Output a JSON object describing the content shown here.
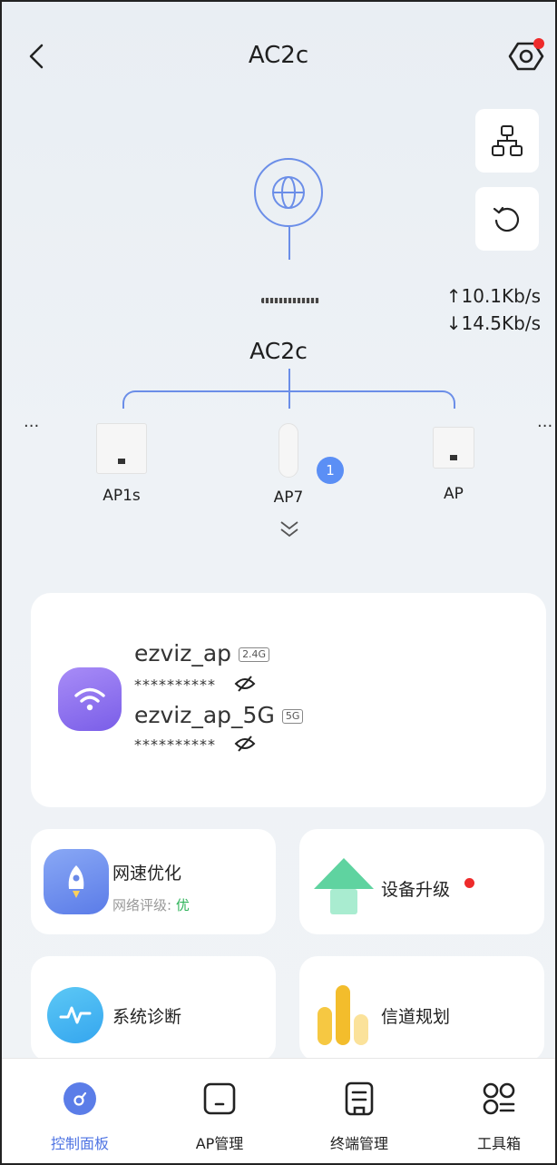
{
  "header": {
    "title": "AC2c"
  },
  "topology": {
    "upload_speed": "10.1Kb/s",
    "download_speed": "14.5Kb/s",
    "upload_arrow": "↑",
    "download_arrow": "↓",
    "controller_label": "AC2c",
    "more_left": "...",
    "more_right": "...",
    "aps": [
      {
        "label": "AP1s"
      },
      {
        "label": "AP7",
        "badge": "1"
      },
      {
        "label": "AP"
      }
    ]
  },
  "wifi": {
    "networks": [
      {
        "ssid": "ezviz_ap",
        "band": "2.4G",
        "password": "**********"
      },
      {
        "ssid": "ezviz_ap_5G",
        "band": "5G",
        "password": "**********"
      }
    ]
  },
  "features": {
    "speed_opt": {
      "title": "网速优化",
      "sub_prefix": "网络评级: ",
      "sub_value": "优"
    },
    "upgrade": {
      "title": "设备升级"
    },
    "diagnose": {
      "title": "系统诊断"
    },
    "channel": {
      "title": "信道规划"
    }
  },
  "tabs": [
    {
      "label": "控制面板",
      "active": true
    },
    {
      "label": "AP管理"
    },
    {
      "label": "终端管理"
    },
    {
      "label": "工具箱"
    }
  ],
  "colors": {
    "accent": "#4f74e3",
    "alert": "#ee2b2b",
    "good": "#2fb35a"
  }
}
